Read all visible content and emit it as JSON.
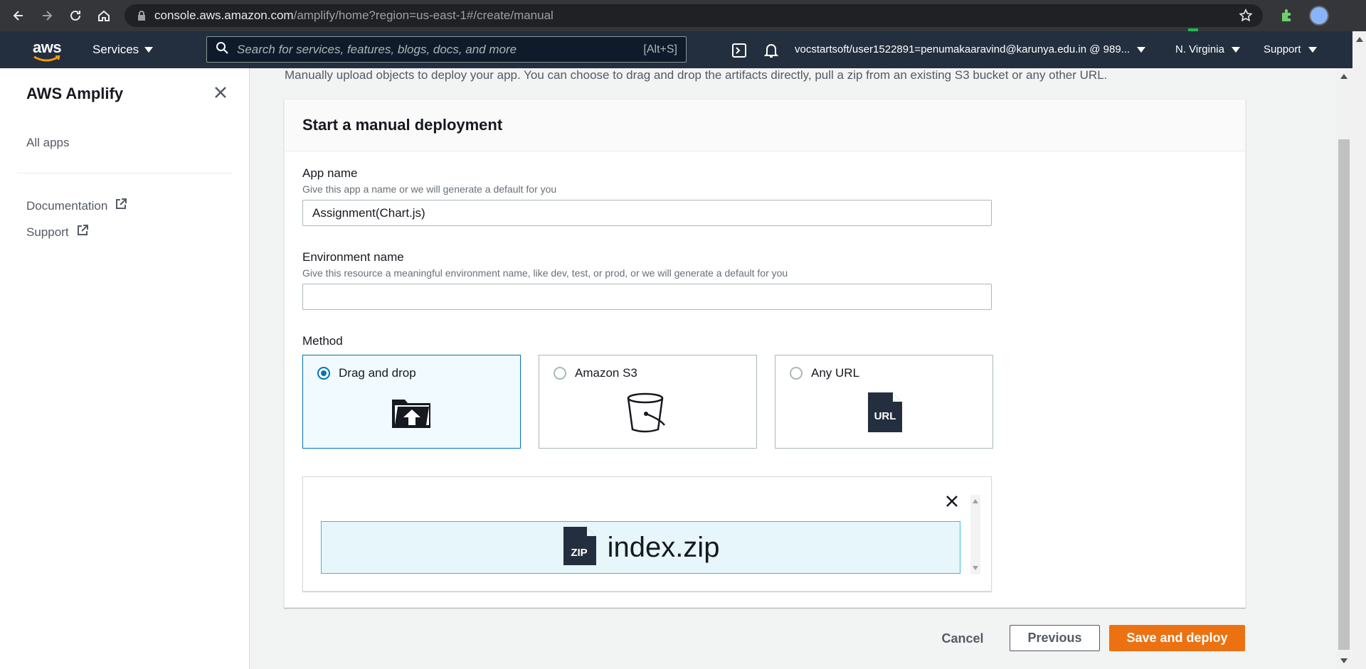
{
  "browser": {
    "url_host": "console.aws.amazon.com",
    "url_path": "/amplify/home?region=us-east-1#/create/manual"
  },
  "topnav": {
    "logo": "aws",
    "services_label": "Services",
    "search_placeholder": "Search for services, features, blogs, docs, and more",
    "search_shortcut": "[Alt+S]",
    "account": "vocstartsoft/user1522891=penumakaaravind@karunya.edu.in @ 989...",
    "region": "N. Virginia",
    "support": "Support"
  },
  "sidebar": {
    "title": "AWS Amplify",
    "items": [
      {
        "label": "All apps"
      },
      {
        "label": "Documentation"
      },
      {
        "label": "Support"
      }
    ]
  },
  "main": {
    "intro": "Manually upload objects to deploy your app. You can choose to drag and drop the artifacts directly, pull a zip from an existing S3 bucket or any other URL.",
    "panel_title": "Start a manual deployment",
    "app_name": {
      "label": "App name",
      "description": "Give this app a name or we will generate a default for you",
      "value": "Assignment(Chart.js)"
    },
    "env_name": {
      "label": "Environment name",
      "description": "Give this resource a meaningful environment name, like dev, test, or prod, or we will generate a default for you",
      "value": ""
    },
    "method": {
      "label": "Method",
      "options": [
        {
          "label": "Drag and drop",
          "icon": "folder-upload-icon",
          "selected": true
        },
        {
          "label": "Amazon S3",
          "icon": "bucket-icon",
          "selected": false
        },
        {
          "label": "Any URL",
          "icon": "url-file-icon",
          "selected": false
        }
      ]
    },
    "upload": {
      "file_name": "index.zip",
      "file_icon_text": "ZIP"
    },
    "url_icon_text": "URL"
  },
  "actions": {
    "cancel": "Cancel",
    "previous": "Previous",
    "save": "Save and deploy"
  },
  "colors": {
    "accent": "#ec7211",
    "selected_border": "#0073bb",
    "nav_bg": "#232f3e"
  }
}
